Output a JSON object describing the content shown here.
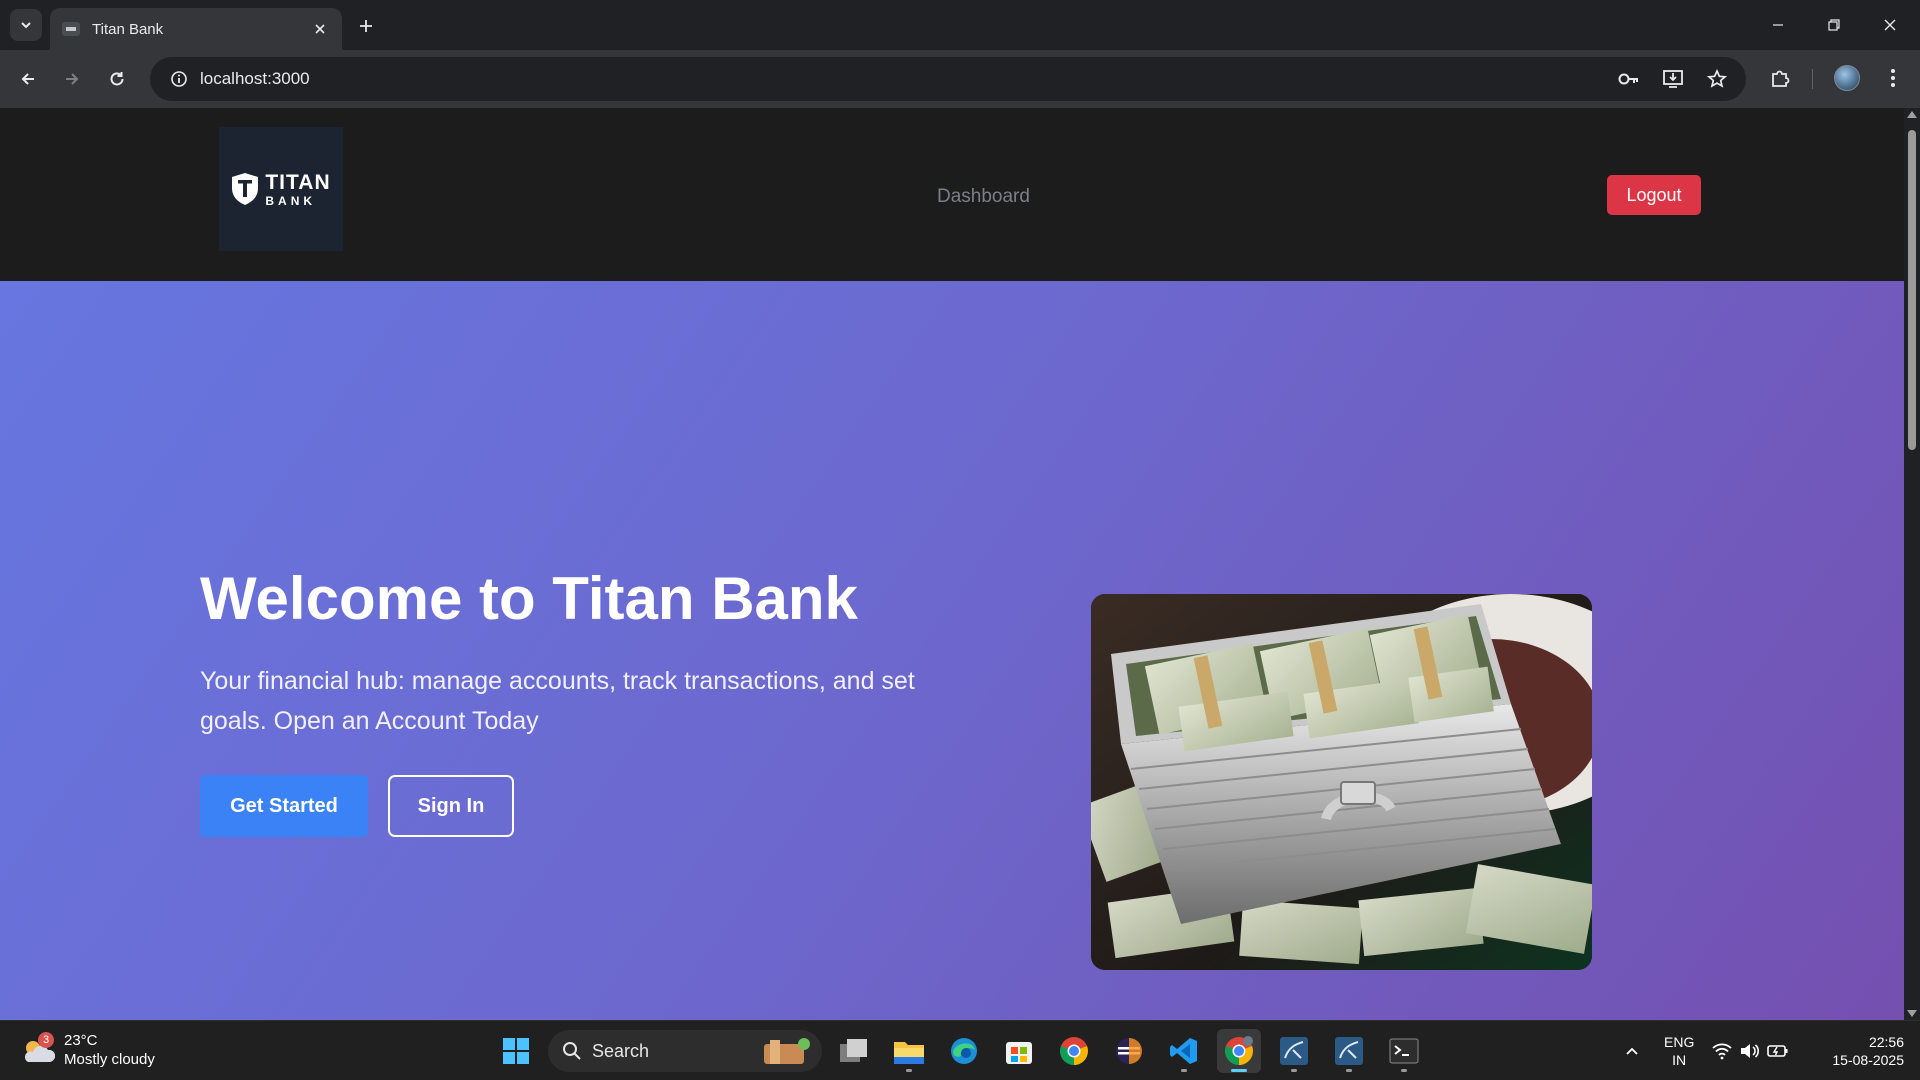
{
  "browser": {
    "tab_title": "Titan Bank",
    "url": "localhost:3000"
  },
  "site": {
    "logo": {
      "line1": "TITAN",
      "line2": "BANK"
    },
    "nav": {
      "dashboard": "Dashboard"
    },
    "logout_label": "Logout",
    "colors": {
      "header_bg": "#1c1c1c",
      "logout": "#dc3545",
      "primary": "#3b82f6",
      "hero_start": "#6776e0",
      "hero_end": "#7450b0"
    }
  },
  "hero": {
    "title": "Welcome to Titan Bank",
    "subtitle": "Your financial hub: manage accounts, track transactions, and set goals. Open an Account Today",
    "primary_button": "Get Started",
    "secondary_button": "Sign In",
    "image_subject": "briefcase-full-of-cash"
  },
  "taskbar": {
    "weather": {
      "temp": "23°C",
      "condition": "Mostly cloudy",
      "badge": "3"
    },
    "search_placeholder": "Search",
    "apps": [
      "start-icon",
      "task-view-icon",
      "file-explorer-icon",
      "edge-icon",
      "store-icon",
      "chrome-icon",
      "eclipse-icon",
      "vscode-icon",
      "chrome-profile-icon",
      "mysql-workbench-icon",
      "mysql-workbench-icon-2",
      "terminal-icon"
    ],
    "language": {
      "line1": "ENG",
      "line2": "IN"
    },
    "time": "22:56",
    "date": "15-08-2025"
  }
}
